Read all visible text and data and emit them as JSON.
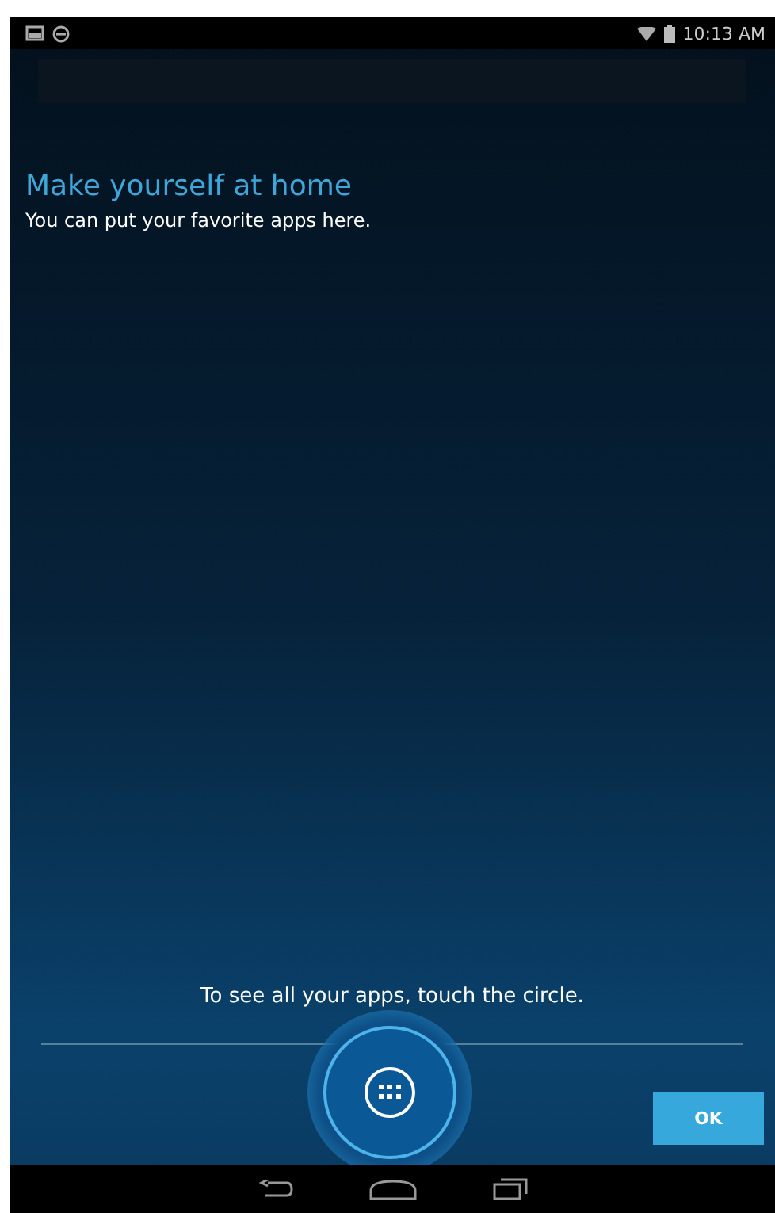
{
  "status_bar": {
    "time": "10:13 AM"
  },
  "intro": {
    "title": "Make yourself at home",
    "subtitle": "You can put your favorite apps here."
  },
  "hint": "To see all your apps, touch the circle.",
  "buttons": [
    {
      "label": "OK",
      "kind": "primary"
    }
  ]
}
